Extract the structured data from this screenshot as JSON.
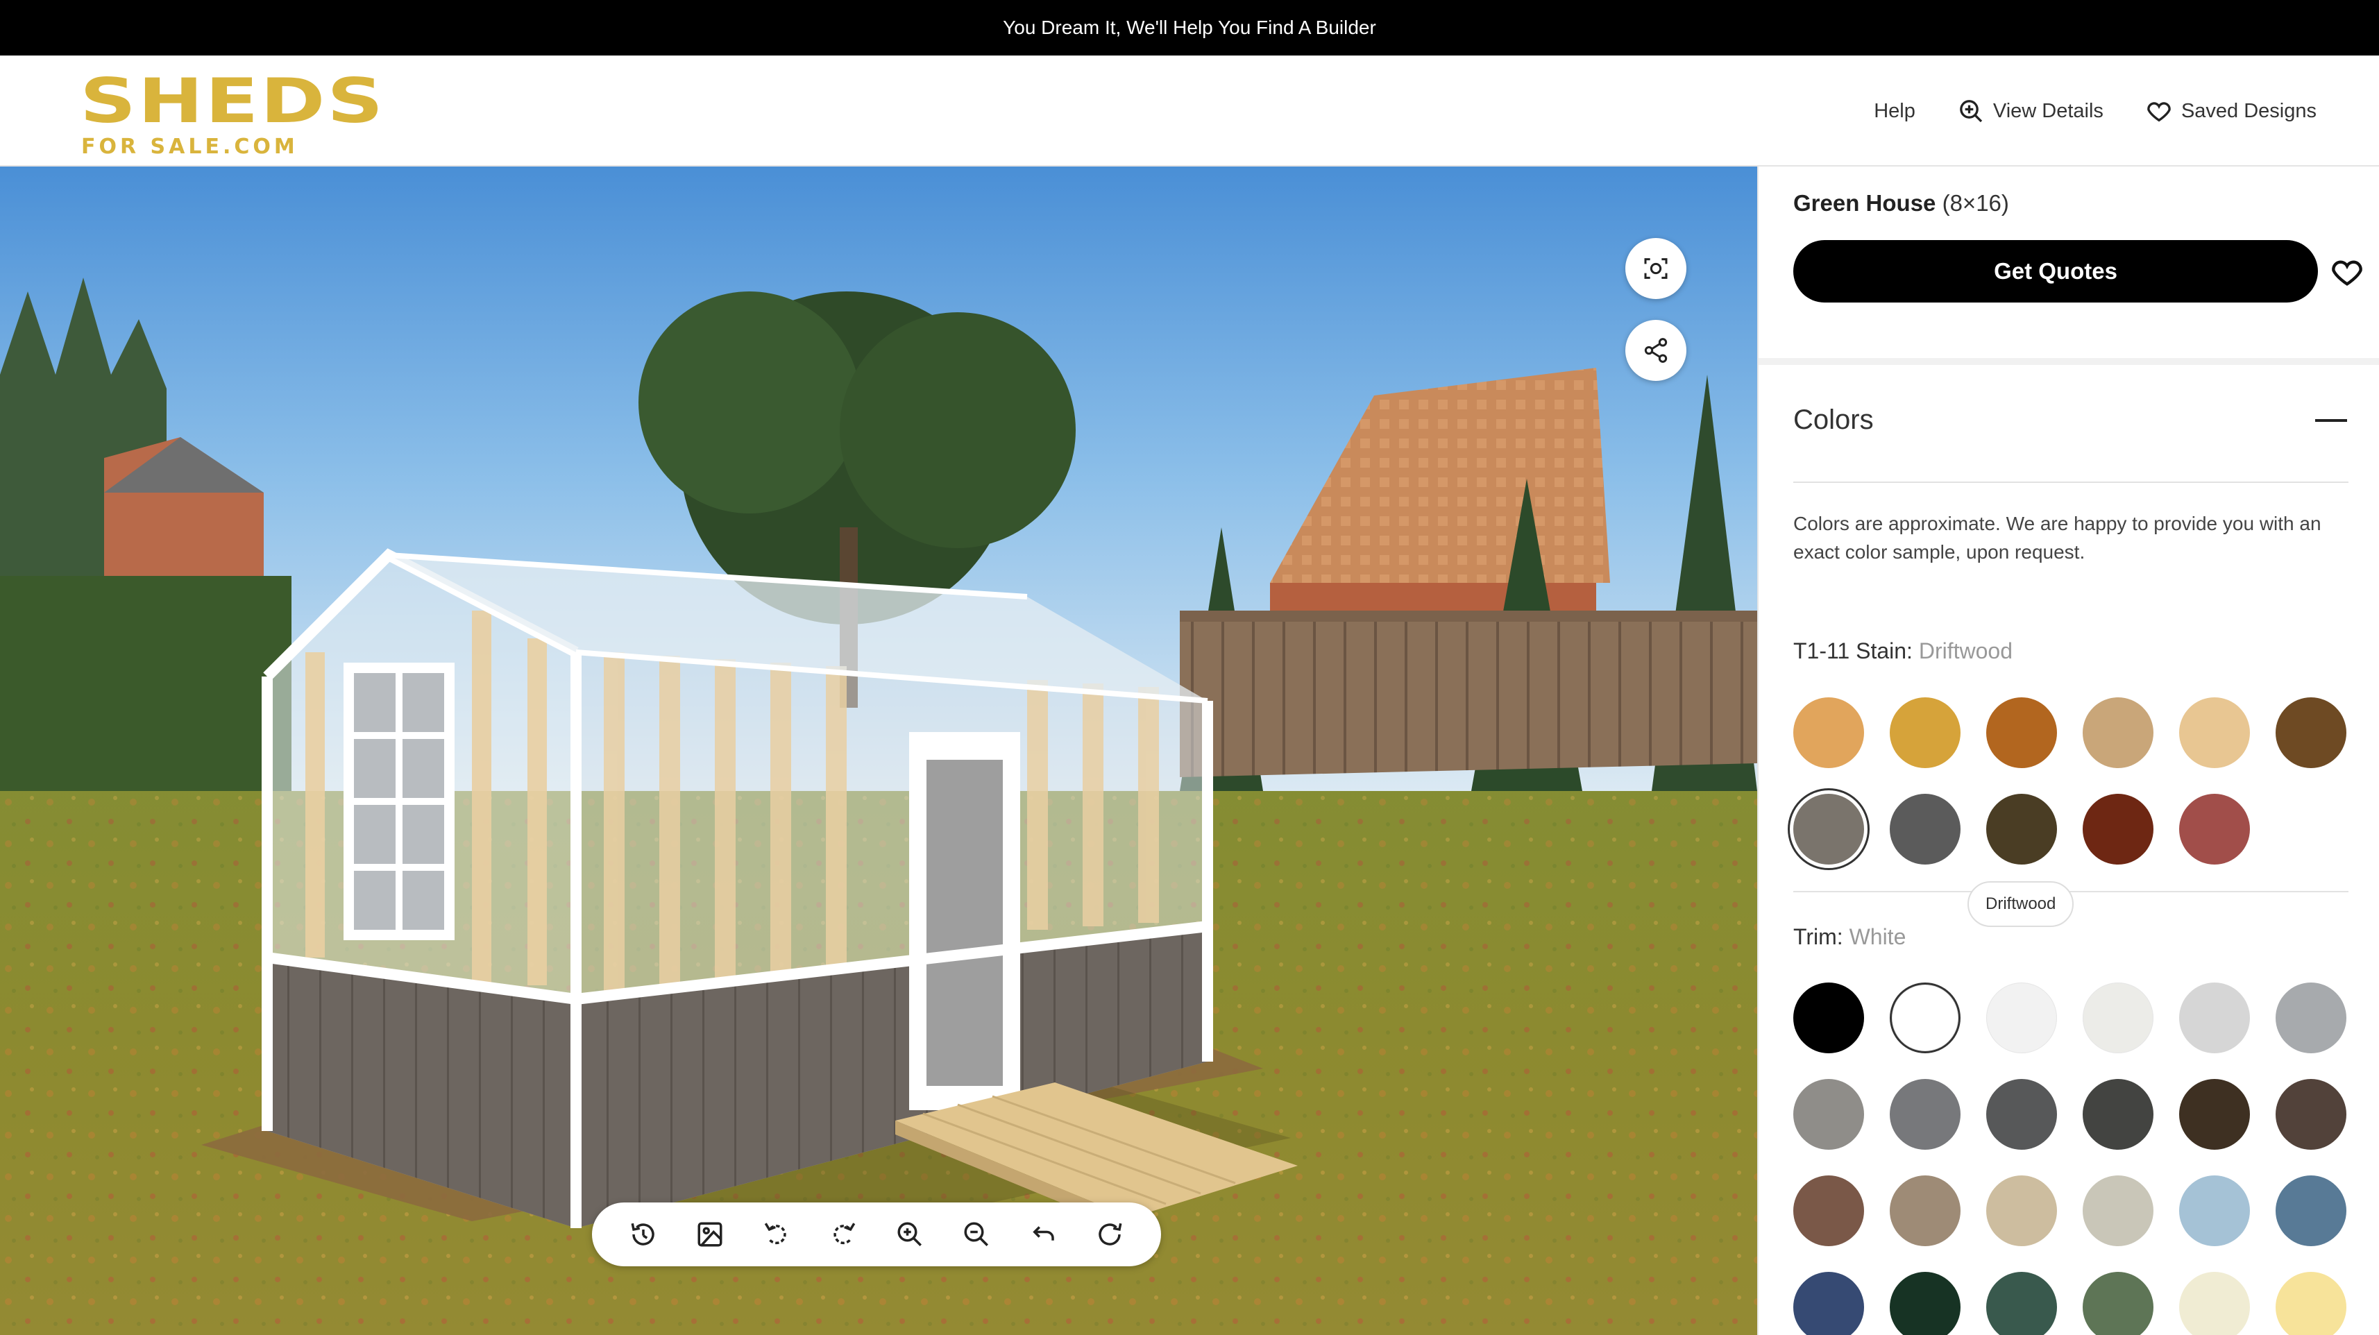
{
  "banner": {
    "text": "You Dream It, We'll Help You Find A Builder"
  },
  "logo": {
    "main": "SHEDS",
    "sub": "FOR SALE.COM"
  },
  "nav": {
    "help": "Help",
    "view_details": "View Details",
    "saved_designs": "Saved Designs",
    "icons": [
      "zoom-in-icon",
      "heart-icon"
    ]
  },
  "viewer": {
    "fab_icons": [
      "ar-scan-icon",
      "share-icon"
    ],
    "toolbar_icons": [
      "reset-view-icon",
      "image-icon",
      "rotate-left-icon",
      "rotate-right-icon",
      "zoom-in-icon",
      "zoom-out-icon",
      "undo-icon",
      "refresh-icon"
    ]
  },
  "panel": {
    "product_name": "Green House",
    "product_size": "(8×16)",
    "quote_label": "Get Quotes",
    "section_title": "Colors",
    "note": "Colors are approximate. We are happy to provide you with an exact color sample, upon request.",
    "stain_label": "T1-11 Stain:",
    "stain_value": "Driftwood",
    "trim_label": "Trim:",
    "trim_value": "White",
    "tooltip": "Driftwood",
    "stain_colors": [
      "#e1a55c",
      "#d6a33a",
      "#b2661f",
      "#c9a679",
      "#e8c692",
      "#6e4a23",
      "#7a746c",
      "#5b5b5b",
      "#4a3d24",
      "#6e2713",
      "#a14e4a"
    ],
    "trim_colors": [
      "#000000",
      "#ffffff",
      "#f2f2f2",
      "#ecece8",
      "#d6d6d6",
      "#a7aaad",
      "#8f8d89",
      "#77787b",
      "#575859",
      "#434441",
      "#3e3022",
      "#52423a",
      "#7a5848",
      "#9e8b76",
      "#cdbd9f",
      "#c9c6b8",
      "#a5c2d6",
      "#587a96",
      "#364a73",
      "#173324",
      "#39594d",
      "#5e7556",
      "#f0ecd3",
      "#f7e39a"
    ]
  }
}
